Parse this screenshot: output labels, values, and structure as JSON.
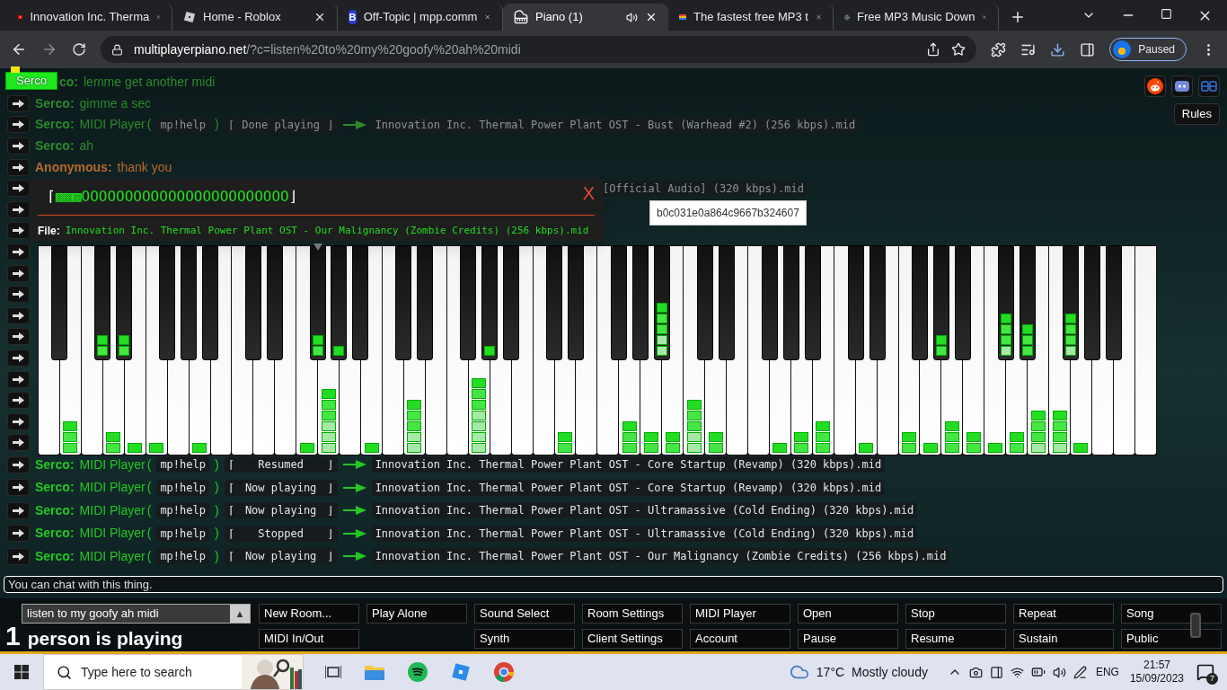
{
  "browser": {
    "tabs": [
      {
        "title": "Innovation Inc. Therma",
        "selected": false,
        "kind": "youtube"
      },
      {
        "title": "Home - Roblox",
        "selected": false,
        "kind": "roblox"
      },
      {
        "title": "Off-Topic | mpp.comm",
        "selected": false,
        "kind": "letter",
        "icon_text": "B"
      },
      {
        "title": "Piano (1)",
        "selected": true,
        "kind": "piano",
        "audio": true
      },
      {
        "title": "The fastest free MP3 t",
        "selected": false,
        "kind": "stack"
      },
      {
        "title": "Free MP3 Music Down",
        "selected": false,
        "kind": "globe"
      }
    ],
    "url": {
      "host": "multiplayerpiano.net",
      "path": "/?c=listen%20to%20my%20goofy%20ah%20midi"
    },
    "profile": {
      "label": "Paused"
    }
  },
  "me_badge": {
    "name": "Serco"
  },
  "site_links": [
    {
      "kind": "reddit"
    },
    {
      "kind": "discord"
    },
    {
      "kind": "bb"
    }
  ],
  "rules_button": "Rules",
  "chat": [
    {
      "kind": "cut",
      "name": "co:",
      "text": "lemme get another midi",
      "color": "#2a8a2a"
    },
    {
      "kind": "message",
      "name": "Serco:",
      "text": "gimme a sec",
      "color": "#2a8a2a"
    },
    {
      "kind": "midi",
      "name": "Serco:",
      "player": "MIDI Player",
      "open_paren": "(",
      "command": "mp!help",
      "close_paren": ")",
      "open_bracket": "⌈",
      "status": "Done playing",
      "close_bracket": "⌋",
      "file": "Innovation Inc. Thermal Power Plant OST - Bust (Warhead #2) (256 kbps).mid",
      "color": "#2a8a2a"
    },
    {
      "kind": "message",
      "name": "Serco:",
      "text": "ah",
      "color": "#2a8a2a"
    },
    {
      "kind": "message",
      "name": "Anonymous:",
      "text": "thank you",
      "color": "#b8692e"
    },
    {
      "kind": "tail",
      "text": "[Official Audio] (320 kbps).mid"
    },
    {
      "kind": "bare"
    },
    {
      "kind": "bare"
    },
    {
      "kind": "bare"
    },
    {
      "kind": "bare"
    },
    {
      "kind": "bare"
    },
    {
      "kind": "bare"
    },
    {
      "kind": "bare"
    },
    {
      "kind": "bare"
    },
    {
      "kind": "bare"
    },
    {
      "kind": "bare"
    },
    {
      "kind": "bare"
    },
    {
      "kind": "bare"
    },
    {
      "kind": "midi",
      "name": "Serco:",
      "player": "MIDI Player",
      "open_paren": "(",
      "command": "mp!help",
      "close_paren": ")",
      "open_bracket": "⌈",
      "status": "Resumed",
      "close_bracket": "⌋",
      "file": "Innovation Inc. Thermal Power Plant OST - Core Startup (Revamp) (320 kbps).mid",
      "color": "#22c722"
    },
    {
      "kind": "midi",
      "name": "Serco:",
      "player": "MIDI Player",
      "open_paren": "(",
      "command": "mp!help",
      "close_paren": ")",
      "open_bracket": "⌈",
      "status": "Now playing",
      "close_bracket": "⌋",
      "file": "Innovation Inc. Thermal Power Plant OST - Core Startup (Revamp) (320 kbps).mid",
      "color": "#22c722"
    },
    {
      "kind": "midi",
      "name": "Serco:",
      "player": "MIDI Player",
      "open_paren": "(",
      "command": "mp!help",
      "close_paren": ")",
      "open_bracket": "⌈",
      "status": "Now playing",
      "close_bracket": "⌋",
      "file": "Innovation Inc. Thermal Power Plant OST - Ultramassive (Cold Ending) (320 kbps).mid",
      "color": "#22c722"
    },
    {
      "kind": "midi",
      "name": "Serco:",
      "player": "MIDI Player",
      "open_paren": "(",
      "command": "mp!help",
      "close_paren": ")",
      "open_bracket": "⌈",
      "status": "Stopped",
      "close_bracket": "⌋",
      "file": "Innovation Inc. Thermal Power Plant OST - Ultramassive (Cold Ending) (320 kbps).mid",
      "color": "#22c722"
    },
    {
      "kind": "midi",
      "name": "Serco:",
      "player": "MIDI Player",
      "open_paren": "(",
      "command": "mp!help",
      "close_paren": ")",
      "open_bracket": "⌈",
      "status": "Now playing",
      "close_bracket": "⌋",
      "file": "Innovation Inc. Thermal Power Plant OST - Our Malignancy (Zombie Credits) (256 kbps).mid",
      "color": "#22c722"
    }
  ],
  "player_popup": {
    "open_bracket": "⌈",
    "filled": "▩▩▩",
    "empty": "OOOOOOOOOOOOOOOOOOOOOOOO",
    "close_bracket": "⌋",
    "close": "X",
    "file_label": "File:",
    "file": "Innovation Inc. Thermal Power Plant OST - Our Malignancy (Zombie Credits) (256 kbps).mid"
  },
  "id_tooltip": "b0c031e0a864c9667b324607",
  "chat_input": {
    "placeholder": "You can chat with this thing."
  },
  "room": {
    "name": "listen to my goofy ah midi",
    "arrow": "▲"
  },
  "players": {
    "count": "1",
    "text": "person is playing"
  },
  "buttons": [
    [
      {
        "kind": "button",
        "label": "New Room..."
      },
      {
        "kind": "button",
        "label": "Play Alone"
      },
      {
        "kind": "button",
        "label": "Sound Select"
      },
      {
        "kind": "button",
        "label": "Room Settings"
      },
      {
        "kind": "button",
        "label": "MIDI Player"
      },
      {
        "kind": "button",
        "label": "Open"
      },
      {
        "kind": "button",
        "label": "Stop"
      },
      {
        "kind": "button",
        "label": "Repeat"
      },
      {
        "kind": "button",
        "label": "Song"
      }
    ],
    [
      {
        "kind": "button",
        "label": "MIDI In/Out"
      },
      {
        "kind": "spacer"
      },
      {
        "kind": "button",
        "label": "Synth"
      },
      {
        "kind": "button",
        "label": "Client Settings"
      },
      {
        "kind": "button",
        "label": "Account"
      },
      {
        "kind": "button",
        "label": "Pause"
      },
      {
        "kind": "button",
        "label": "Resume"
      },
      {
        "kind": "button",
        "label": "Sustain"
      },
      {
        "kind": "button",
        "label": "Public"
      }
    ]
  ],
  "taskbar": {
    "search": {
      "placeholder": "Type here to search"
    },
    "weather": {
      "temp": "17°C",
      "text": "Mostly cloudy"
    },
    "lang": "ENG",
    "time": "21:57",
    "date": "15/09/2023",
    "notifications": "7"
  }
}
